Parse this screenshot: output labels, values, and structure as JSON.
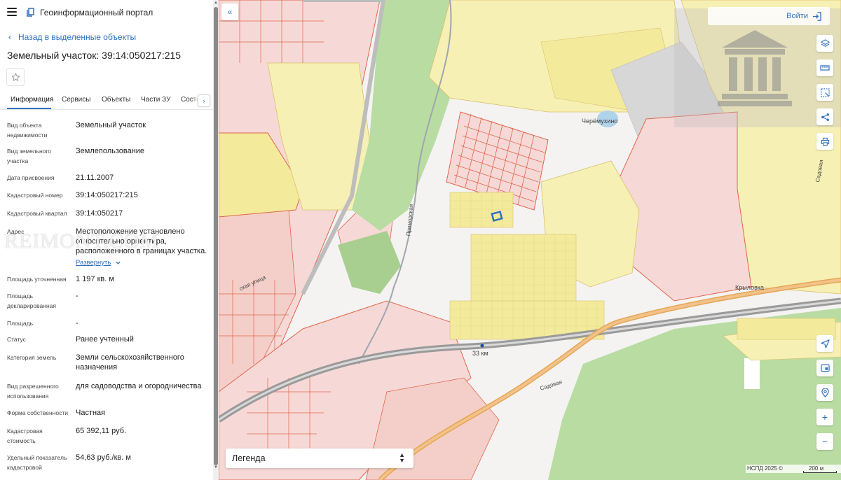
{
  "app": {
    "portal_title": "Геоинформационный портал"
  },
  "panel": {
    "back_link": "Назад в выделенные объекты",
    "object_title": "Земельный участок: 39:14:050217:215",
    "tabs": [
      {
        "label": "Информация"
      },
      {
        "label": "Сервисы"
      },
      {
        "label": "Объекты"
      },
      {
        "label": "Части ЗУ"
      },
      {
        "label": "Соста"
      }
    ],
    "attributes": [
      {
        "label": "Вид объекта недвижимости",
        "value": "Земельный участок"
      },
      {
        "label": "Вид земельного участка",
        "value": "Землепользование"
      },
      {
        "label": "Дата присвоения",
        "value": "21.11.2007"
      },
      {
        "label": "Кадастровый номер",
        "value": "39:14:050217:215"
      },
      {
        "label": "Кадастровый квартал",
        "value": "39:14:050217"
      },
      {
        "label": "Адрес",
        "value": "Местоположение установлено относительно ориентира, расположенного в границах участка.",
        "expand": "Развернуть"
      },
      {
        "label": "Площадь уточненная",
        "value": "1 197 кв. м"
      },
      {
        "label": "Площадь декларированная",
        "value": "-"
      },
      {
        "label": "Площадь",
        "value": "-"
      },
      {
        "label": "Статус",
        "value": "Ранее учтенный"
      },
      {
        "label": "Категория земель",
        "value": "Земли сельскохозяйственного назначения"
      },
      {
        "label": "Вид разрешенного использования",
        "value": "для садоводства и огородничества"
      },
      {
        "label": "Форма собственности",
        "value": "Частная"
      },
      {
        "label": "Кадастровая стоимость",
        "value": "65 392,11 руб."
      },
      {
        "label": "Удельный показатель кадастровой",
        "value": "54,63 руб./кв. м"
      }
    ],
    "watermark": "REIMONT.COM"
  },
  "map": {
    "login_label": "Войти",
    "legend_label": "Легенда",
    "attribution": "НСПД 2025 ©",
    "scale_label": "200 м",
    "place_labels": {
      "cheremukhino": "Черёмухино",
      "krylovka": "Крыловка",
      "km": "33  км",
      "sadovaya1": "Садовая",
      "sadovaya2": "Садовая",
      "street1": "Приморская",
      "street2": "ская улица"
    },
    "colors": {
      "accent": "#2d6fbf",
      "parcel_yellow": "#f7f0b4",
      "parcel_pink": "#f6d9d6",
      "parcel_border": "#e0654d",
      "forest_green": "#b9dca2",
      "railway": "#8f8f8f",
      "road_orange": "#f2c28a"
    },
    "icons": [
      "layers-icon",
      "ruler-icon",
      "select-area-icon",
      "share-icon",
      "print-icon",
      "locate-icon",
      "map-mode-icon",
      "geo-search-icon",
      "zoom-in-icon",
      "zoom-out-icon"
    ]
  }
}
